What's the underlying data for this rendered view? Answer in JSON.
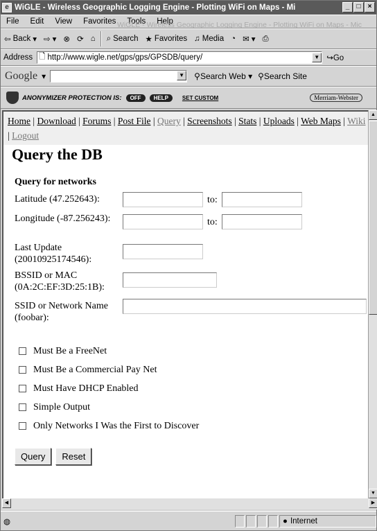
{
  "window": {
    "title": "WiGLE - Wireless Geographic Logging Engine - Plotting WiFi on Maps - Mi"
  },
  "menu": {
    "items": [
      "File",
      "Edit",
      "View",
      "Favorites",
      "Tools",
      "Help"
    ],
    "ghost": "WiGLE - Wireless Geographic Logging Engine - Plotting WiFi on Maps - Mic"
  },
  "toolbar": {
    "back": "Back",
    "search": "Search",
    "favorites": "Favorites",
    "media": "Media"
  },
  "address": {
    "label": "Address",
    "url": "http://www.wigle.net/gps/gps/GPSDB/query/",
    "go": "Go"
  },
  "google": {
    "logo": "Google",
    "search_web": "Search Web",
    "search_site": "Search Site"
  },
  "anonymizer": {
    "text": "ANONYMIZER PROTECTION IS:",
    "off": "OFF",
    "help": "HELP",
    "custom": "SET CUSTOM",
    "mw": "Merriam-Webster"
  },
  "nav": {
    "links": [
      "Home",
      "Download",
      "Forums",
      "Post File",
      "Query",
      "Screenshots",
      "Stats",
      "Uploads",
      "Web Maps",
      "Wiki",
      "Logout"
    ]
  },
  "page": {
    "title": "Query the DB",
    "subtitle": "Query for networks"
  },
  "form": {
    "lat_label": "Latitude (47.252643):",
    "lon_label": "Longitude (-87.256243):",
    "to": "to:",
    "update_label": "Last Update (20010925174546):",
    "bssid_label": "BSSID or MAC (0A:2C:EF:3D:25:1B):",
    "ssid_label": "SSID or Network Name (foobar):",
    "checks": [
      "Must Be a FreeNet",
      "Must Be a Commercial Pay Net",
      "Must Have DHCP Enabled",
      "Simple Output",
      "Only Networks I Was the First to Discover"
    ],
    "query_btn": "Query",
    "reset_btn": "Reset"
  },
  "status": {
    "zone": "Internet"
  }
}
